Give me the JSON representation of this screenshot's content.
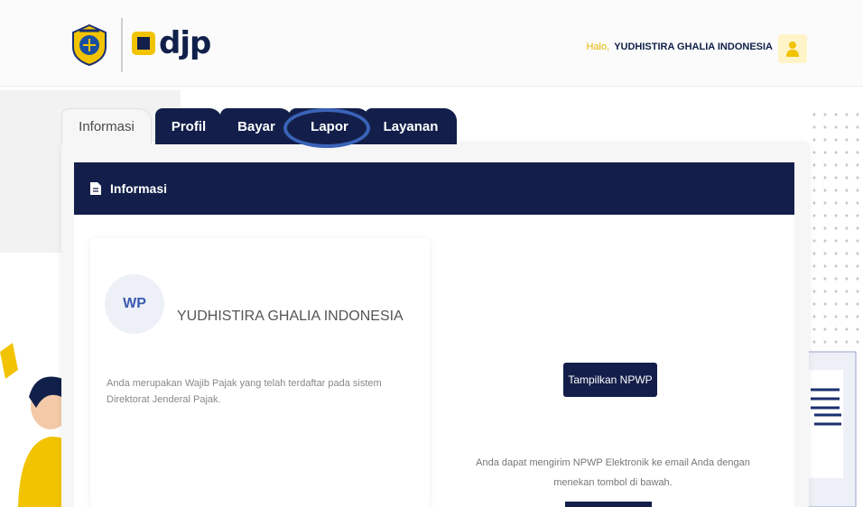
{
  "header": {
    "greeting_prefix": "Halo,",
    "user_name": "YUDHISTIRA GHALIA INDONESIA",
    "logo_text": "djp"
  },
  "tabs": [
    {
      "label": "Informasi",
      "active": true
    },
    {
      "label": "Profil",
      "active": false
    },
    {
      "label": "Bayar",
      "active": false
    },
    {
      "label": "Lapor",
      "active": false
    },
    {
      "label": "Layanan",
      "active": false
    }
  ],
  "section": {
    "title": "Informasi"
  },
  "taxpayer": {
    "badge": "WP",
    "name": "YUDHISTIRA GHALIA INDONESIA",
    "description": "Anda merupakan Wajib Pajak yang telah terdaftar pada sistem Direktorat Jenderal Pajak."
  },
  "npwp": {
    "button_label": "Tampilkan NPWP",
    "info": "Anda dapat mengirim NPWP Elektronik ke email Anda dengan menekan tombol di bawah."
  },
  "colors": {
    "navy": "#131f4a",
    "gold": "#f2c300",
    "highlight": "#3a63b8"
  }
}
